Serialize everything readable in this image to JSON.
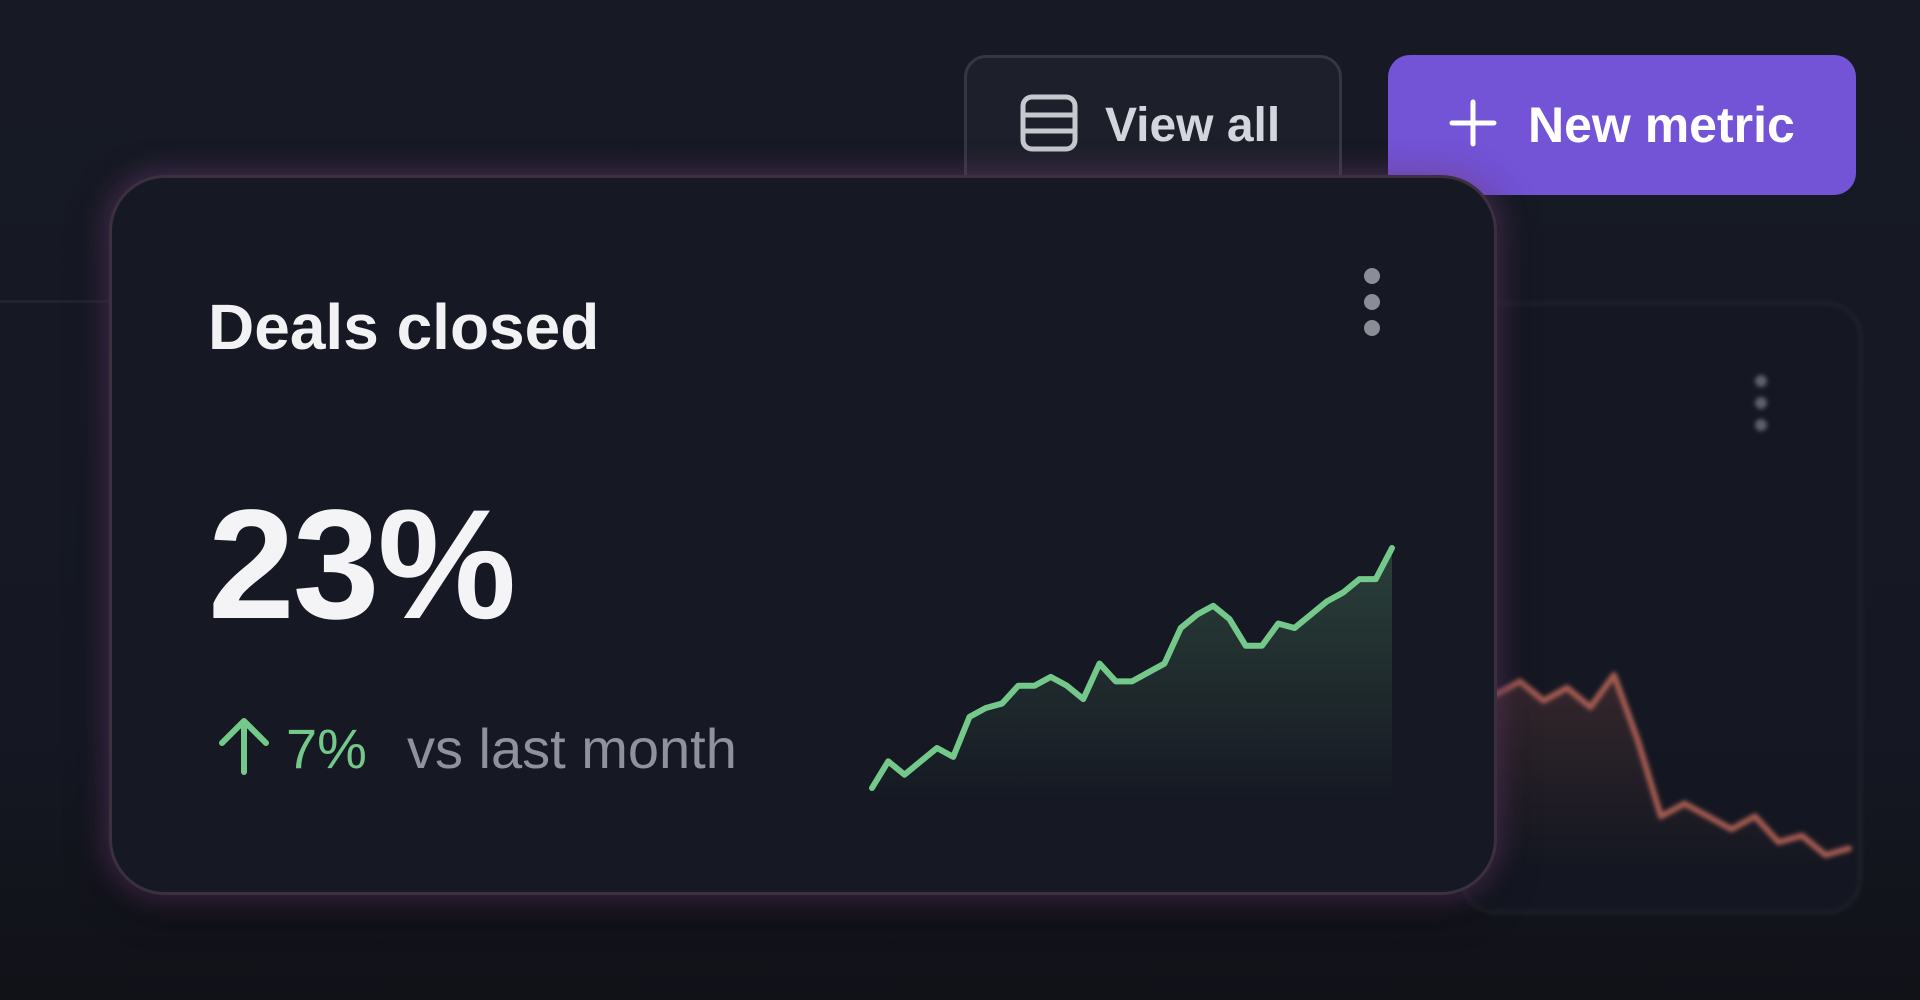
{
  "toolbar": {
    "view_all": {
      "label": "View all",
      "icon": "table-icon"
    },
    "new_metric": {
      "label": "New metric",
      "icon": "plus-icon"
    }
  },
  "card": {
    "title": "Deals closed",
    "value": "23%",
    "delta": {
      "direction": "up",
      "value": "7%",
      "comparison": "vs last month"
    },
    "menu_icon": "more-vertical-icon"
  },
  "colors": {
    "accent": "#7353d6",
    "positive": "#74c98a",
    "negative": "#c0685a",
    "card_bg": "#161923"
  },
  "sparkline_main": {
    "trend": "up",
    "values": [
      8,
      14,
      11,
      14,
      17,
      15,
      24,
      26,
      27,
      31,
      31,
      33,
      31,
      28,
      36,
      32,
      32,
      34,
      36,
      44,
      47,
      49,
      46,
      40,
      40,
      45,
      44,
      47,
      50,
      52,
      55,
      55,
      62
    ]
  },
  "sparkline_back": {
    "trend": "down",
    "values": [
      50,
      47,
      49,
      46,
      48,
      45,
      50,
      40,
      28,
      30,
      28,
      26,
      28,
      24,
      25,
      22,
      23
    ]
  }
}
